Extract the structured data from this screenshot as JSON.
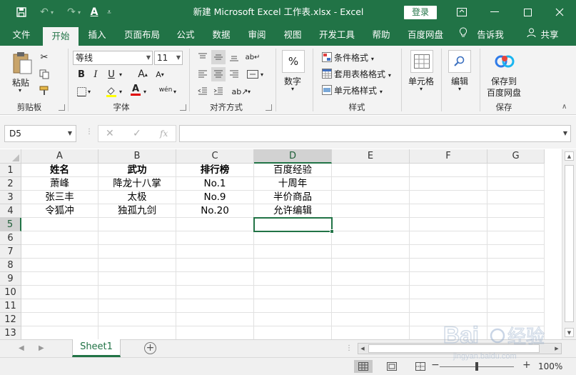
{
  "window": {
    "title": "新建 Microsoft Excel 工作表.xlsx  -  Excel",
    "login_label": "登录",
    "accent_color": "#217346"
  },
  "quick_access": [
    "save-icon",
    "undo-icon",
    "redo-icon",
    "format-painter-icon",
    "customize-icon"
  ],
  "tabs": {
    "file": "文件",
    "home": "开始",
    "insert": "插入",
    "layout": "页面布局",
    "formulas": "公式",
    "data": "数据",
    "review": "审阅",
    "view": "视图",
    "developer": "开发工具",
    "help": "帮助",
    "baidu": "百度网盘",
    "tell_me": "告诉我",
    "share": "共享"
  },
  "ribbon": {
    "clipboard": {
      "paste": "粘贴",
      "group": "剪贴板"
    },
    "font": {
      "name": "等线",
      "size": "11",
      "bold": "B",
      "italic": "I",
      "underline": "U",
      "group": "字体"
    },
    "alignment": {
      "group": "对齐方式"
    },
    "number": {
      "label": "数字",
      "symbol": "%"
    },
    "styles": {
      "conditional": "条件格式",
      "table": "套用表格格式",
      "cell": "单元格样式",
      "group": "样式"
    },
    "cells": {
      "label": "单元格"
    },
    "editing": {
      "label": "编辑"
    },
    "save": {
      "line1": "保存到",
      "line2": "百度网盘",
      "group": "保存"
    }
  },
  "formula_bar": {
    "name_box": "D5",
    "fx": "fx",
    "value": ""
  },
  "sheet": {
    "columns": [
      "A",
      "B",
      "C",
      "D",
      "E",
      "F",
      "G"
    ],
    "rows": [
      "1",
      "2",
      "3",
      "4",
      "5",
      "6",
      "7",
      "8",
      "9",
      "10",
      "11",
      "12",
      "13"
    ],
    "selected_cell": "D5",
    "cells": [
      [
        "姓名",
        "武功",
        "排行榜",
        "百度经验"
      ],
      [
        "萧峰",
        "降龙十八掌",
        "No.1",
        "十周年"
      ],
      [
        "张三丰",
        "太极",
        "No.9",
        "半价商品"
      ],
      [
        "令狐冲",
        "独孤九剑",
        "No.20",
        "允许编辑"
      ]
    ]
  },
  "sheet_tabs": {
    "active": "Sheet1"
  },
  "status": {
    "zoom": "100%",
    "zoom_level": 1.0
  },
  "watermark": {
    "brand": "Baidu经验",
    "url": "jingyan.baidu.com"
  }
}
